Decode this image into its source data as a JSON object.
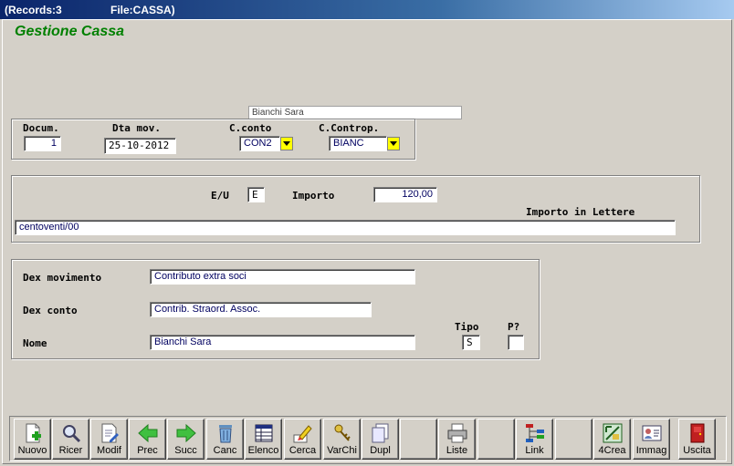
{
  "window": {
    "records": "(Records:3",
    "file": "File:CASSA)"
  },
  "app_title": "Gestione Cassa",
  "header_name": "Bianchi Sara",
  "doc_group": {
    "docum_label": "Docum.",
    "docum_value": "1",
    "dta_label": "Dta mov.",
    "dta_value": "25-10-2012",
    "cconto_label": "C.conto",
    "cconto_value": "CON2",
    "ccontrop_label": "C.Controp.",
    "ccontrop_value": "BIANC"
  },
  "amount_group": {
    "eu_label": "E/U",
    "eu_value": "E",
    "importo_label": "Importo",
    "importo_value": "120,00",
    "lettere_label": "Importo in Lettere",
    "lettere_value": "centoventi/00"
  },
  "dex_group": {
    "dexmov_label": "Dex movimento",
    "dexmov_value": "Contributo extra soci",
    "dexconto_label": "Dex conto",
    "dexconto_value": "Contrib. Straord. Assoc.",
    "nome_label": "Nome",
    "nome_value": "Bianchi Sara",
    "tipo_label": "Tipo",
    "tipo_value": "S",
    "p_label": "P?",
    "p_value": ""
  },
  "toolbar": {
    "nuovo": "Nuovo",
    "ricer": "Ricer",
    "modif": "Modif",
    "prec": "Prec",
    "succ": "Succ",
    "canc": "Canc",
    "elenco": "Elenco",
    "cerca": "Cerca",
    "varchi": "VarChi",
    "dupl": "Dupl",
    "liste": "Liste",
    "link": "Link",
    "crea4": "4Crea",
    "immag": "Immag",
    "uscita": "Uscita"
  },
  "colors": {
    "title_green": "#008000",
    "combo_yellow": "#ffff00",
    "titlebar_blue": "#0a246a"
  }
}
